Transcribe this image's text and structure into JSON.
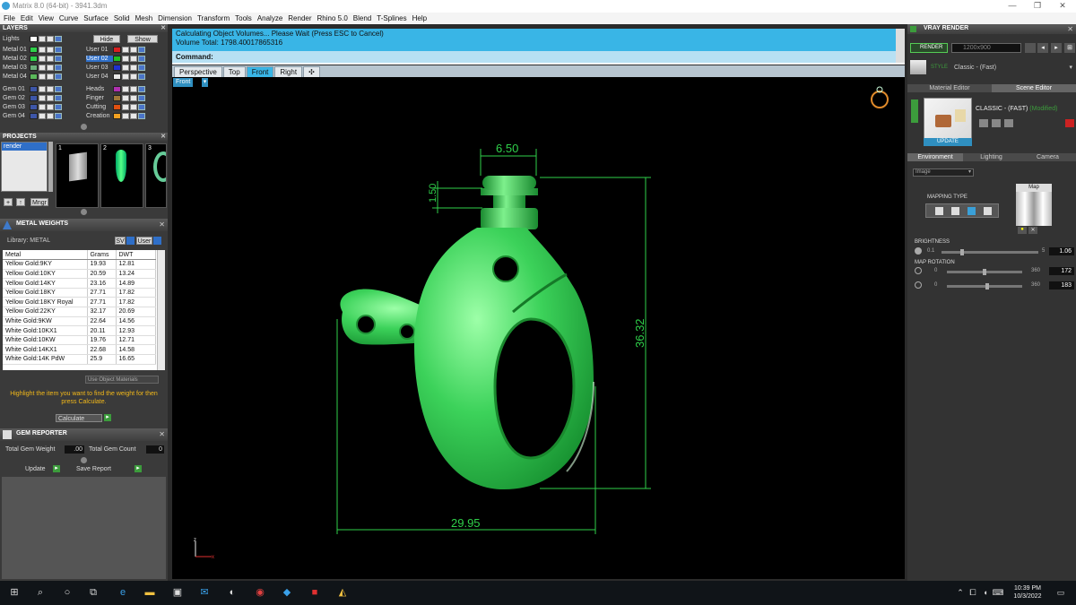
{
  "window": {
    "title": "Matrix 8.0 (64-bit) - 3941.3dm",
    "controls": [
      "—",
      "❐",
      "✕"
    ]
  },
  "menu": [
    "File",
    "Edit",
    "View",
    "Curve",
    "Surface",
    "Solid",
    "Mesh",
    "Dimension",
    "Transform",
    "Tools",
    "Analyze",
    "Render",
    "Rhino 5.0",
    "Blend",
    "T-Splines",
    "Help"
  ],
  "layers": {
    "header": "LAYERS",
    "lights_label": "Lights",
    "hide_label": "Hide",
    "show_label": "Show",
    "left_rows": [
      {
        "name": "Metal 01",
        "color": "#2fd04a"
      },
      {
        "name": "Metal 02",
        "color": "#2fd04a"
      },
      {
        "name": "Metal 03",
        "color": "#6ab07a"
      },
      {
        "name": "Metal 04",
        "color": "#5ab85a"
      },
      {
        "name": "Gem 01",
        "color": "#3d56a8"
      },
      {
        "name": "Gem 02",
        "color": "#3d56a8"
      },
      {
        "name": "Gem 03",
        "color": "#3d56a8"
      },
      {
        "name": "Gem 04",
        "color": "#3d56a8"
      }
    ],
    "right_rows": [
      {
        "name": "User 01",
        "color": "#d82020"
      },
      {
        "name": "User 02",
        "color": "#20c020"
      },
      {
        "name": "User 03",
        "color": "#2030d0"
      },
      {
        "name": "User 04",
        "color": "#e8e8e8"
      },
      {
        "name": "Heads",
        "color": "#b030b0"
      },
      {
        "name": "Finger",
        "color": "#a07838"
      },
      {
        "name": "Cutting",
        "color": "#e05010"
      },
      {
        "name": "Creation",
        "color": "#f0a020"
      }
    ],
    "selected_user": "User 02"
  },
  "projects": {
    "header": "PROJECTS",
    "list_item": "render",
    "thumbs": [
      "1",
      "2",
      "3"
    ],
    "mngr_label": "Mngr"
  },
  "metal_weights": {
    "header": "METAL WEIGHTS",
    "library_label": "Library: METAL",
    "sv_label": "SV",
    "user_label": "User",
    "columns": [
      "Metal",
      "Grams",
      "DWT"
    ],
    "rows": [
      [
        "Yellow Gold:9KY",
        "19.93",
        "12.81"
      ],
      [
        "Yellow Gold:10KY",
        "20.59",
        "13.24"
      ],
      [
        "Yellow Gold:14KY",
        "23.16",
        "14.89"
      ],
      [
        "Yellow Gold:18KY",
        "27.71",
        "17.82"
      ],
      [
        "Yellow Gold:18KY Royal",
        "27.71",
        "17.82"
      ],
      [
        "Yellow Gold:22KY",
        "32.17",
        "20.69"
      ],
      [
        "White Gold:9KW",
        "22.64",
        "14.56"
      ],
      [
        "White Gold:10KX1",
        "20.11",
        "12.93"
      ],
      [
        "White Gold:10KW",
        "19.76",
        "12.71"
      ],
      [
        "White Gold:14KX1",
        "22.68",
        "14.58"
      ],
      [
        "White Gold:14K PdW",
        "25.9",
        "16.65"
      ]
    ],
    "use_object_materials": "Use Object Materials",
    "hint": "Highlight the item you want to find the weight for then press Calculate.",
    "calculate_label": "Calculate"
  },
  "gem_reporter": {
    "header": "GEM REPORTER",
    "total_weight_label": "Total Gem Weight",
    "total_weight_value": ".00",
    "total_count_label": "Total Gem Count",
    "total_count_value": "0",
    "update_label": "Update",
    "save_label": "Save Report"
  },
  "command": {
    "message_line1": "Calculating Object Volumes... Please Wait (Press ESC to Cancel)",
    "message_line2": "Volume Total: 1798.40017865316",
    "prompt": "Command:"
  },
  "viewport_tabs": [
    "Perspective",
    "Top",
    "Front",
    "Right",
    "✣"
  ],
  "active_tab": "Front",
  "viewport_label": "Front",
  "dimensions": {
    "top_width": "6.50",
    "knob_height": "1.50",
    "height": "36.32",
    "width": "29.95"
  },
  "axis_labels": {
    "z": "z",
    "x": "x"
  },
  "vray": {
    "header": "VRAY RENDER",
    "render_label": "RENDER",
    "resolution": "1200x900",
    "style_label": "STYLE",
    "style_value": "Classic - (Fast)",
    "tab_material": "Material Editor",
    "tab_scene": "Scene Editor",
    "scene_name": "CLASSIC - (FAST)",
    "scene_modified": "(Modified)",
    "update_label": "UPDATE",
    "env_tabs": [
      "Environment",
      "Lighting",
      "Camera"
    ],
    "image_dropdown": "Image",
    "map_label": "Map",
    "mapping_type_label": "MAPPING TYPE",
    "brightness_label": "BRIGHTNESS",
    "brightness_min": "0.1",
    "brightness_max": "5",
    "brightness_value": "1.06",
    "map_rotation_label": "MAP ROTATION",
    "rot1_min": "0",
    "rot1_max": "360",
    "rot1_value": "172",
    "rot2_min": "0",
    "rot2_max": "360",
    "rot2_value": "183"
  },
  "taskbar": {
    "time": "10:39 PM",
    "date": "10/3/2022"
  }
}
